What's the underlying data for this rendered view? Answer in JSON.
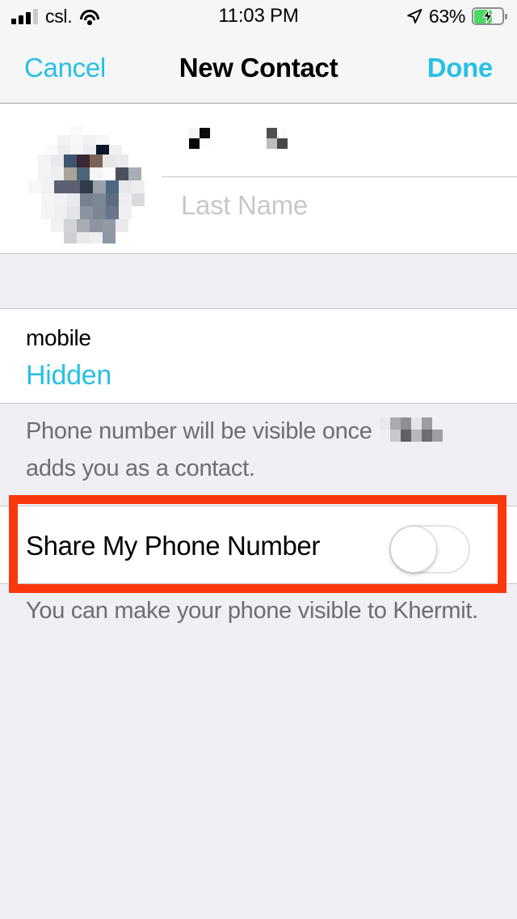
{
  "status_bar": {
    "carrier": "csl.",
    "time": "11:03 PM",
    "battery_percent": "63%",
    "signal_bars_filled": 3,
    "signal_bars_total": 4,
    "wifi": "wifi-icon",
    "location": "location-arrow-icon",
    "battery_state": "charging"
  },
  "nav": {
    "cancel_label": "Cancel",
    "title": "New Contact",
    "done_label": "Done"
  },
  "contact": {
    "photo": "contact-photo-redacted",
    "first_name_value": "",
    "first_name_redacted": true,
    "last_name_placeholder": "Last Name"
  },
  "phone": {
    "label": "mobile",
    "value": "Hidden",
    "footnote_before": "Phone number will be visible once",
    "footnote_after": "adds you as a contact.",
    "footnote_name_redacted": true
  },
  "share_toggle": {
    "label": "Share My Phone Number",
    "state": "off",
    "footnote": "You can make your phone visible to Khermit."
  },
  "colors": {
    "accent_tint": "#27c0e6",
    "highlight": "#f9380e",
    "battery_green": "#4cd964",
    "group_background": "#efeff4",
    "card_background": "#ffffff",
    "separator": "#c8c7cc",
    "secondary_text": "#6d6d72",
    "placeholder_text": "#c7c7cd"
  }
}
